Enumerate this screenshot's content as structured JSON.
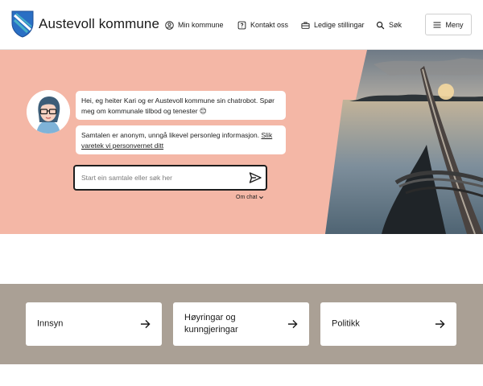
{
  "header": {
    "brand": "Austevoll kommune",
    "nav": [
      {
        "label": "Min kommune",
        "icon": "user-circle-icon"
      },
      {
        "label": "Kontakt oss",
        "icon": "question-icon"
      },
      {
        "label": "Ledige stillingar",
        "icon": "briefcase-icon"
      },
      {
        "label": "Søk",
        "icon": "search-icon"
      }
    ],
    "menu_label": "Meny"
  },
  "chatbot": {
    "message_1": "Hei, eg heiter Kari og er Austevoll kommune sin chatrobot. Spør meg om kommunale tilbod og tenester 😊",
    "message_2_text": "Samtalen er anonym, unngå likevel personleg informasjon. ",
    "message_2_link": "Slik varetek vi personvernet ditt",
    "input_placeholder": "Start ein samtale eller søk her",
    "about_label": "Om chat"
  },
  "cards": [
    {
      "label": "Innsyn"
    },
    {
      "label": "Høyringar og kunngjeringar"
    },
    {
      "label": "Politikk"
    }
  ],
  "colors": {
    "hero_background": "#f4b7a6",
    "band_background": "#aaa095",
    "logo_blue": "#2a6fc4",
    "logo_teal": "#46b1c6"
  }
}
